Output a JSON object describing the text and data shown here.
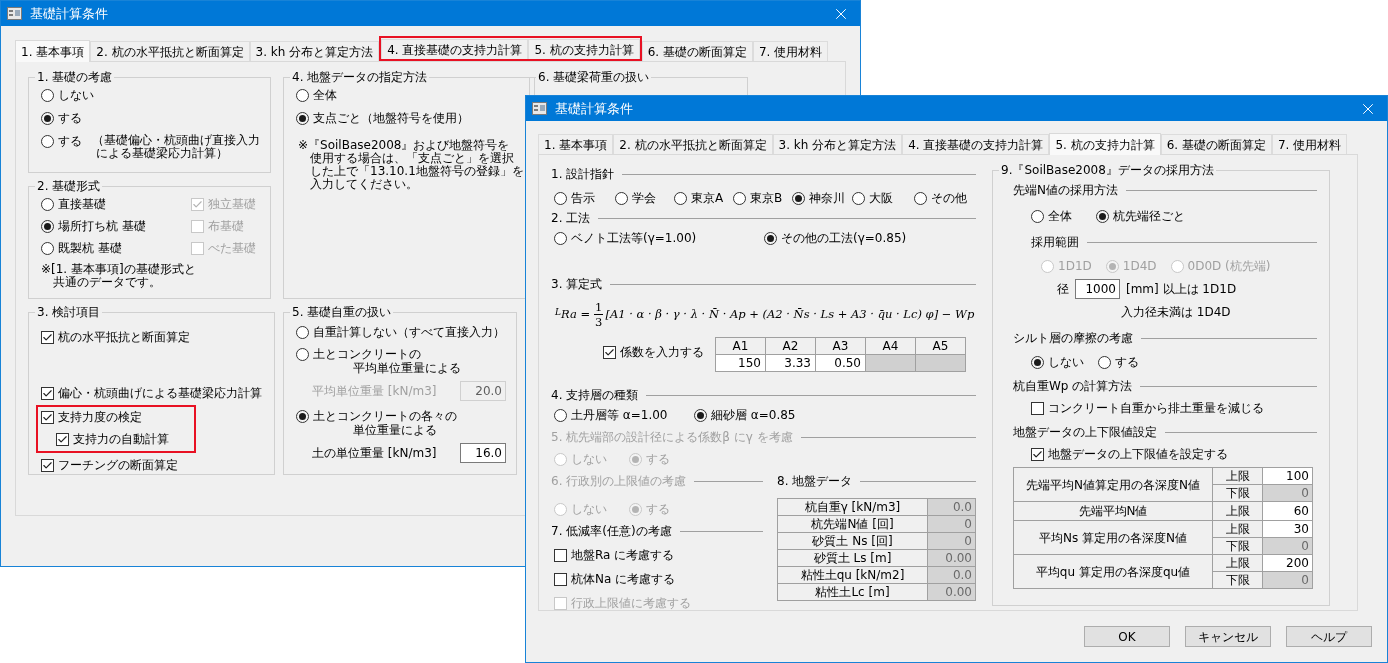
{
  "back_window": {
    "title": "基礎計算条件",
    "tabs": [
      {
        "label": "1. 基本事項",
        "selected": true,
        "highlighted": false
      },
      {
        "label": "2. 杭の水平抵抗と断面算定",
        "selected": false,
        "highlighted": false
      },
      {
        "label": "3. kh 分布と算定方法",
        "selected": false,
        "highlighted": false
      },
      {
        "label": "4. 直接基礎の支持力計算",
        "selected": false,
        "highlighted": true
      },
      {
        "label": "5. 杭の支持力計算",
        "selected": false,
        "highlighted": true
      },
      {
        "label": "6. 基礎の断面算定",
        "selected": false,
        "highlighted": false
      },
      {
        "label": "7. 使用材料",
        "selected": false,
        "highlighted": false
      }
    ],
    "consideration": {
      "title": "1. 基礎の考慮",
      "options": [
        {
          "label": "しない",
          "selected": false
        },
        {
          "label": "する",
          "selected": true
        },
        {
          "label": "する",
          "selected": false,
          "note_lines": [
            "（基礎偏心・杭頭曲げ直接入力",
            "による基礎梁応力計算）"
          ]
        }
      ]
    },
    "form": {
      "title": "2. 基礎形式",
      "options": [
        {
          "label": "直接基礎",
          "selected": false
        },
        {
          "label": "場所打ち杭 基礎",
          "selected": true
        },
        {
          "label": "既製杭 基礎",
          "selected": false
        }
      ],
      "checks": [
        {
          "label": "独立基礎",
          "checked": true,
          "disabled": true
        },
        {
          "label": "布基礎",
          "checked": false,
          "disabled": true
        },
        {
          "label": "べた基礎",
          "checked": false,
          "disabled": true
        }
      ],
      "note_lines": [
        "※[1. 基本事項]の基礎形式と",
        "共通のデータです。"
      ]
    },
    "items": {
      "title": "3. 検討項目",
      "items": [
        {
          "label": "杭の水平抵抗と断面算定",
          "checked": true,
          "highlighted": false
        },
        {
          "label": "偏心・杭頭曲げによる基礎梁応力計算",
          "checked": true,
          "highlighted": false
        },
        {
          "label": "支持力度の検定",
          "checked": true,
          "highlighted": true,
          "children": [
            {
              "label": "支持力の自動計算",
              "checked": true,
              "highlighted": false
            }
          ]
        },
        {
          "label": "フーチングの断面算定",
          "checked": true,
          "highlighted": false
        }
      ]
    },
    "ground": {
      "title": "4. 地盤データの指定方法",
      "options": [
        {
          "label": "全体",
          "selected": false
        },
        {
          "label": "支点ごと（地盤符号を使用）",
          "selected": true
        }
      ],
      "note_lines": [
        "※『SoilBase2008』および地盤符号を",
        "使用する場合は、「支点ごと」を選択",
        "した上で「13.10.1地盤符号の登録」を",
        "入力してください。"
      ]
    },
    "self_weight": {
      "title": "5. 基礎自重の扱い",
      "options": [
        {
          "label_lines": [
            "自重計算しない（すべて直接入力）"
          ],
          "selected": false
        },
        {
          "label_lines": [
            "土とコンクリートの",
            "平均単位重量による"
          ],
          "selected": false,
          "field": {
            "label": "平均単位重量 [kN/m3]",
            "value": "20.0",
            "disabled": true
          }
        },
        {
          "label_lines": [
            "土とコンクリートの各々の",
            "単位重量による"
          ],
          "selected": true,
          "field": {
            "label": "土の単位重量 [kN/m3]",
            "value": "16.0",
            "disabled": false
          }
        }
      ]
    },
    "beam_load": {
      "title": "6. 基礎梁荷重の扱い"
    }
  },
  "front_window": {
    "title": "基礎計算条件",
    "tabs": [
      {
        "label": "1. 基本事項",
        "selected": false,
        "highlighted": false
      },
      {
        "label": "2. 杭の水平抵抗と断面算定",
        "selected": false,
        "highlighted": false
      },
      {
        "label": "3. kh 分布と算定方法",
        "selected": false,
        "highlighted": false
      },
      {
        "label": "4. 直接基礎の支持力計算",
        "selected": false,
        "highlighted": false
      },
      {
        "label": "5. 杭の支持力計算",
        "selected": true,
        "highlighted": false
      },
      {
        "label": "6. 基礎の断面算定",
        "selected": false,
        "highlighted": false
      },
      {
        "label": "7. 使用材料",
        "selected": false,
        "highlighted": false
      }
    ],
    "guideline": {
      "title": "1. 設計指針",
      "options": [
        {
          "label": "告示",
          "selected": false
        },
        {
          "label": "学会",
          "selected": false
        },
        {
          "label": "東京A",
          "selected": false
        },
        {
          "label": "東京B",
          "selected": false
        },
        {
          "label": "神奈川",
          "selected": true
        },
        {
          "label": "大阪",
          "selected": false
        },
        {
          "label": "その他",
          "selected": false
        }
      ]
    },
    "method": {
      "title": "2. 工法",
      "options": [
        {
          "label": "ベノト工法等(γ=1.00)",
          "selected": false
        },
        {
          "label": "その他の工法(γ=0.85)",
          "selected": true
        }
      ]
    },
    "formula": {
      "title": "3. 算定式",
      "prefix": "L",
      "lhs": "Ra =",
      "numerator": "1",
      "denominator": "3",
      "body": "[A1 · α · β · γ · λ · N̄ · Ap + (A2 · N̄s · Ls + A3 · q̄u · Lc) φ] − Wp",
      "coef_check": {
        "label": "係数を入力する",
        "checked": true
      },
      "columns": [
        "A1",
        "A2",
        "A3",
        "A4",
        "A5"
      ],
      "cells": [
        {
          "value": "150",
          "disabled": false
        },
        {
          "value": "3.33",
          "disabled": false
        },
        {
          "value": "0.50",
          "disabled": false
        },
        {
          "disabled": true
        },
        {
          "disabled": true
        }
      ]
    },
    "bearing_layer": {
      "title": "4. 支持層の種類",
      "options": [
        {
          "label": "土丹層等 α=1.00",
          "selected": false
        },
        {
          "label": "細砂層 α=0.85",
          "selected": true
        }
      ]
    },
    "beta": {
      "title": "5. 杭先端部の設計径による係数β にγ を考慮",
      "disabled": true,
      "options": [
        {
          "label": "しない",
          "selected": false
        },
        {
          "label": "する",
          "selected": true
        }
      ]
    },
    "limit": {
      "title": "6. 行政別の上限値の考慮",
      "disabled": true,
      "options": [
        {
          "label": "しない",
          "selected": false
        },
        {
          "label": "する",
          "selected": true
        }
      ]
    },
    "reduction": {
      "title": "7. 低減率(任意)の考慮",
      "checks": [
        {
          "label": "地盤Ra に考慮する",
          "checked": false,
          "disabled": false
        },
        {
          "label": "杭体Na に考慮する",
          "checked": false,
          "disabled": false
        },
        {
          "label": "行政上限値に考慮する",
          "checked": false,
          "disabled": true
        }
      ]
    },
    "soil": {
      "title": "8. 地盤データ",
      "disabled": true,
      "rows": [
        {
          "label": "杭自重γ [kN/m3]",
          "value": "0.0"
        },
        {
          "label": "杭先端N値 [回]",
          "value": "0"
        },
        {
          "label": "砂質土 Ns [回]",
          "value": "0"
        },
        {
          "label": "砂質土 Ls [m]",
          "value": "0.00"
        },
        {
          "label": "粘性土qu [kN/m2]",
          "value": "0.0"
        },
        {
          "label": "粘性土Lc [m]",
          "value": "0.00"
        }
      ]
    },
    "soilbase": {
      "title": "9.『SoilBase2008』データの採用方法",
      "tip": {
        "title": "先端N値の採用方法",
        "options": [
          {
            "label": "全体",
            "selected": false
          },
          {
            "label": "杭先端径ごと",
            "selected": true
          }
        ]
      },
      "range": {
        "title": "採用範囲",
        "disabled": true,
        "options": [
          {
            "label": "1D1D",
            "selected": false
          },
          {
            "label": "1D4D",
            "selected": true
          },
          {
            "label": "0D0D (杭先端)",
            "selected": false
          }
        ]
      },
      "diameter": {
        "prefix": "径",
        "value": "1000",
        "suffix": "[mm] 以上は 1D1D",
        "note": "入力径未満は 1D4D"
      },
      "silt": {
        "title": "シルト層の摩擦の考慮",
        "options": [
          {
            "label": "しない",
            "selected": true
          },
          {
            "label": "する",
            "selected": false
          }
        ]
      },
      "weight": {
        "title": "杭自重Wp の計算方法",
        "check": {
          "label": "コンクリート自重から排土重量を減じる",
          "checked": false
        }
      },
      "limits": {
        "title": "地盤データの上下限値設定",
        "check": {
          "label": "地盤データの上下限値を設定する",
          "checked": true
        },
        "rows": [
          {
            "label": "先端平均N値算定用の各深度N値",
            "limits": [
              {
                "label": "上限",
                "value": "100",
                "disabled": false
              },
              {
                "label": "下限",
                "value": "0",
                "disabled": true
              }
            ]
          },
          {
            "label": "先端平均N値",
            "limits": [
              {
                "label": "上限",
                "value": "60",
                "disabled": false
              }
            ]
          },
          {
            "label": "平均Ns 算定用の各深度N値",
            "limits": [
              {
                "label": "上限",
                "value": "30",
                "disabled": false
              },
              {
                "label": "下限",
                "value": "0",
                "disabled": true
              }
            ]
          },
          {
            "label": "平均qu 算定用の各深度qu値",
            "limits": [
              {
                "label": "上限",
                "value": "200",
                "disabled": false
              },
              {
                "label": "下限",
                "value": "0",
                "disabled": true
              }
            ]
          }
        ]
      }
    },
    "buttons": [
      "OK",
      "キャンセル",
      "ヘルプ"
    ]
  }
}
